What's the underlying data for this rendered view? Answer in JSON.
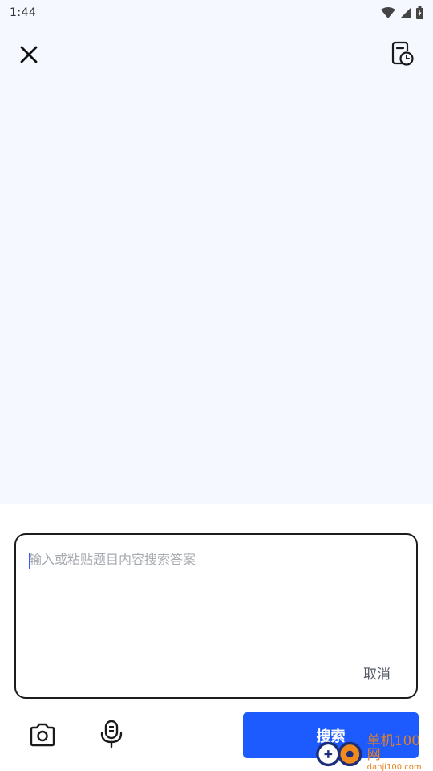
{
  "status_bar": {
    "time": "1:44",
    "icons": [
      "wifi-icon",
      "cellular-signal-icon",
      "battery-icon"
    ]
  },
  "top_bar": {
    "close_icon": "close-icon",
    "history_icon": "search-history-icon"
  },
  "input": {
    "placeholder": "输入或粘贴题目内容搜索答案",
    "value": "",
    "cancel_label": "取消"
  },
  "toolbar": {
    "camera_icon": "camera-icon",
    "mic_icon": "microphone-icon",
    "search_label": "搜索"
  },
  "watermark": {
    "main": "单机100网",
    "sub": "danji100.com"
  },
  "colors": {
    "background": "#f5f8ff",
    "accent": "#1d5bff",
    "border": "#1c1c1c",
    "watermark": "#e8801c"
  }
}
